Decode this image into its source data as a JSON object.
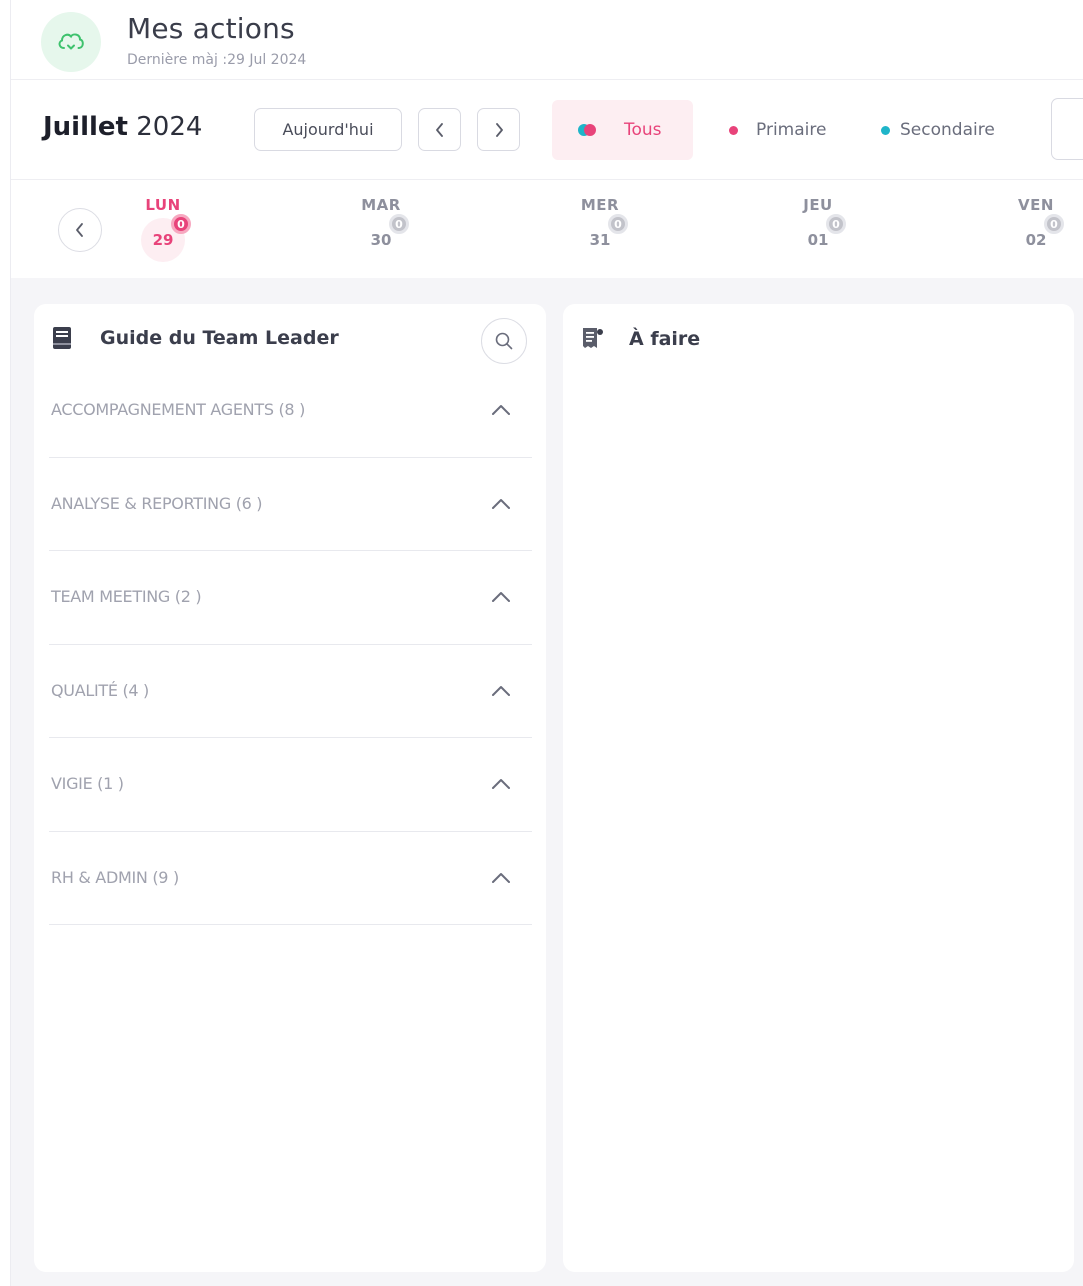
{
  "header": {
    "title": "Mes actions",
    "last_update": "Dernière màj :29 Jul 2024",
    "logo_icon": "cloud-sync-icon"
  },
  "toolbar": {
    "month": "Juillet",
    "year": "2024",
    "today_label": "Aujourd'hui",
    "filters": {
      "all": "Tous",
      "primary": "Primaire",
      "secondary": "Secondaire"
    }
  },
  "days": [
    {
      "name": "LUN",
      "num": "29",
      "badge": "0",
      "active": true
    },
    {
      "name": "MAR",
      "num": "30",
      "badge": "0",
      "active": false
    },
    {
      "name": "MER",
      "num": "31",
      "badge": "0",
      "active": false
    },
    {
      "name": "JEU",
      "num": "01",
      "badge": "0",
      "active": false
    },
    {
      "name": "VEN",
      "num": "02",
      "badge": "0",
      "active": false
    }
  ],
  "guide": {
    "title": "Guide du Team Leader",
    "categories": [
      {
        "label": "ACCOMPAGNEMENT AGENTS (8 )"
      },
      {
        "label": "ANALYSE & REPORTING (6 )"
      },
      {
        "label": "TEAM MEETING (2 )"
      },
      {
        "label": "QUALITÉ (4 )"
      },
      {
        "label": "VIGIE (1 )"
      },
      {
        "label": "RH & ADMIN (9 )"
      }
    ]
  },
  "todo": {
    "title": "À faire"
  },
  "colors": {
    "accent": "#e8437a",
    "secondary": "#1fb5c9",
    "logo_bg": "#e6f7ec",
    "logo_icon": "#3ec26d"
  }
}
